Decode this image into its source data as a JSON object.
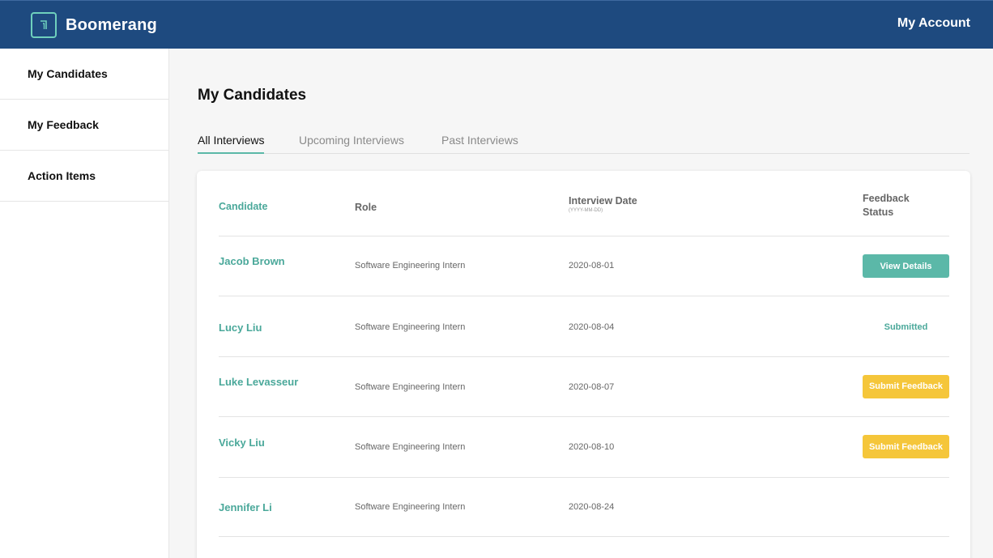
{
  "header": {
    "brand": "Boomerang",
    "account": "My Account"
  },
  "sidebar": {
    "items": [
      {
        "label": "My Candidates"
      },
      {
        "label": "My Feedback"
      },
      {
        "label": "Action Items"
      }
    ]
  },
  "main": {
    "title": "My Candidates",
    "tabs": [
      {
        "label": "All Interviews"
      },
      {
        "label": "Upcoming Interviews"
      },
      {
        "label": "Past Interviews"
      }
    ]
  },
  "table": {
    "headers": {
      "candidate": "Candidate",
      "role": "Role",
      "date": "Interview Date",
      "date_format": "(YYYY-MM-DD)",
      "status_line1": "Feedback",
      "status_line2": "Status"
    },
    "rows": [
      {
        "name": "Jacob Brown",
        "role": "Software Engineering Intern",
        "date": "2020-08-01",
        "status": "View Details"
      },
      {
        "name": "Lucy Liu",
        "role": "Software Engineering Intern",
        "date": "2020-08-04",
        "status": "Submitted"
      },
      {
        "name": "Luke Levasseur",
        "role": "Software Engineering Intern",
        "date": "2020-08-07",
        "status": "Submit Feedback"
      },
      {
        "name": "Vicky Liu",
        "role": "Software Engineering Intern",
        "date": "2020-08-10",
        "status": "Submit Feedback"
      },
      {
        "name": "Jennifer Li",
        "role": "Software Engineering Intern",
        "date": "2020-08-24",
        "status": ""
      }
    ]
  },
  "colors": {
    "header_bg": "#1e4a7f",
    "accent_teal": "#5bb8a8",
    "accent_yellow": "#f5c63a",
    "icons": [
      "boomerang-logo-icon"
    ]
  }
}
